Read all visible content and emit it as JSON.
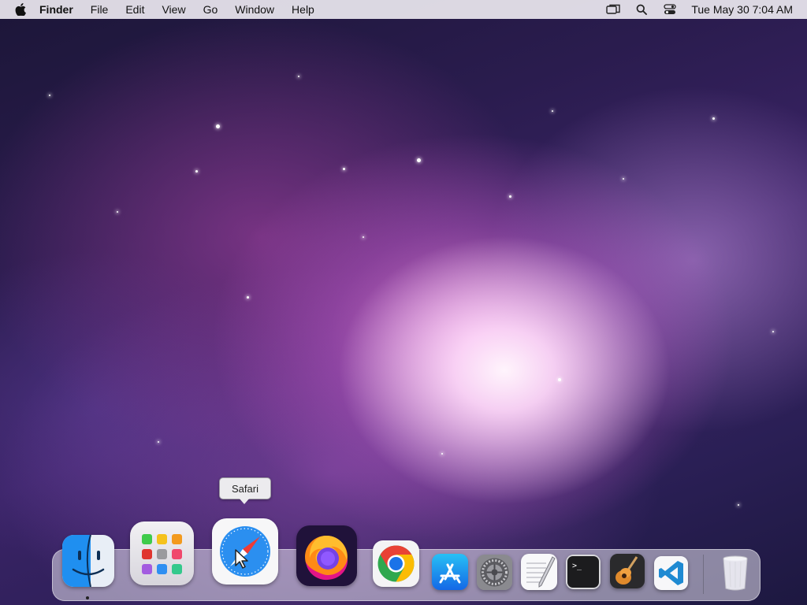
{
  "menubar": {
    "app_name": "Finder",
    "menus": [
      "File",
      "Edit",
      "View",
      "Go",
      "Window",
      "Help"
    ],
    "status_icons": [
      "screen-mirroring-icon",
      "spotlight-search-icon",
      "control-center-icon"
    ],
    "clock": "Tue May 30  7:04 AM"
  },
  "tooltip": {
    "text": "Safari"
  },
  "dock": {
    "apps": [
      {
        "name": "Finder",
        "icon": "finder-icon",
        "running": true
      },
      {
        "name": "Launchpad",
        "icon": "launchpad-icon",
        "running": false
      },
      {
        "name": "Safari",
        "icon": "safari-icon",
        "running": false,
        "hovered": true
      },
      {
        "name": "Firefox",
        "icon": "firefox-icon",
        "running": false
      },
      {
        "name": "Google Chrome",
        "icon": "chrome-icon",
        "running": false
      },
      {
        "name": "App Store",
        "icon": "app-store-icon",
        "running": false
      },
      {
        "name": "System Preferences",
        "icon": "system-preferences-icon",
        "running": false
      },
      {
        "name": "TextEdit",
        "icon": "textedit-icon",
        "running": false
      },
      {
        "name": "Terminal",
        "icon": "terminal-icon",
        "running": false
      },
      {
        "name": "GarageBand",
        "icon": "garageband-icon",
        "running": false
      },
      {
        "name": "Visual Studio Code",
        "icon": "vscode-icon",
        "running": false
      },
      {
        "name": "Trash",
        "icon": "trash-icon",
        "running": false
      }
    ],
    "terminal_prompt": ">_"
  },
  "colors": {
    "menubar_bg": "#ece8f0",
    "wallpaper_dark": "#1c1638",
    "nebula_glow": "#e882dc",
    "tooltip_bg": "#ecebee"
  }
}
